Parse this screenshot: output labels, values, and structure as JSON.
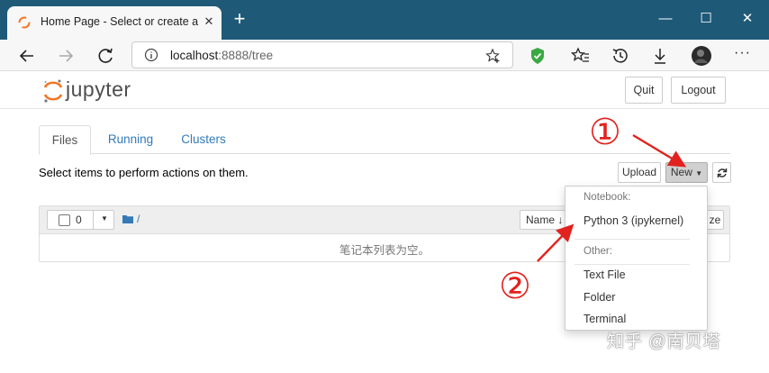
{
  "browser": {
    "tab_title": "Home Page - Select or create a n",
    "url_host": "localhost",
    "url_path": ":8888/tree",
    "accent": "#1e5a78"
  },
  "header": {
    "logo_text": "jupyter",
    "quit_label": "Quit",
    "logout_label": "Logout"
  },
  "tabs": [
    {
      "label": "Files"
    },
    {
      "label": "Running"
    },
    {
      "label": "Clusters"
    }
  ],
  "toolbar": {
    "message": "Select items to perform actions on them.",
    "upload_label": "Upload",
    "new_label": "New",
    "refresh_icon": "refresh-icon"
  },
  "list": {
    "selected_count": "0",
    "root_path": "/",
    "name_sort_label": "Name",
    "size_label": "ze",
    "empty_message": "笔记本列表为空。"
  },
  "new_menu": {
    "notebook_header": "Notebook:",
    "python3": "Python 3 (ipykernel)",
    "other_header": "Other:",
    "text_file": "Text File",
    "folder": "Folder",
    "terminal": "Terminal"
  },
  "annotations": {
    "one": "①",
    "two": "②",
    "color": "#e1221e"
  },
  "watermark": "知乎 @南贝塔"
}
